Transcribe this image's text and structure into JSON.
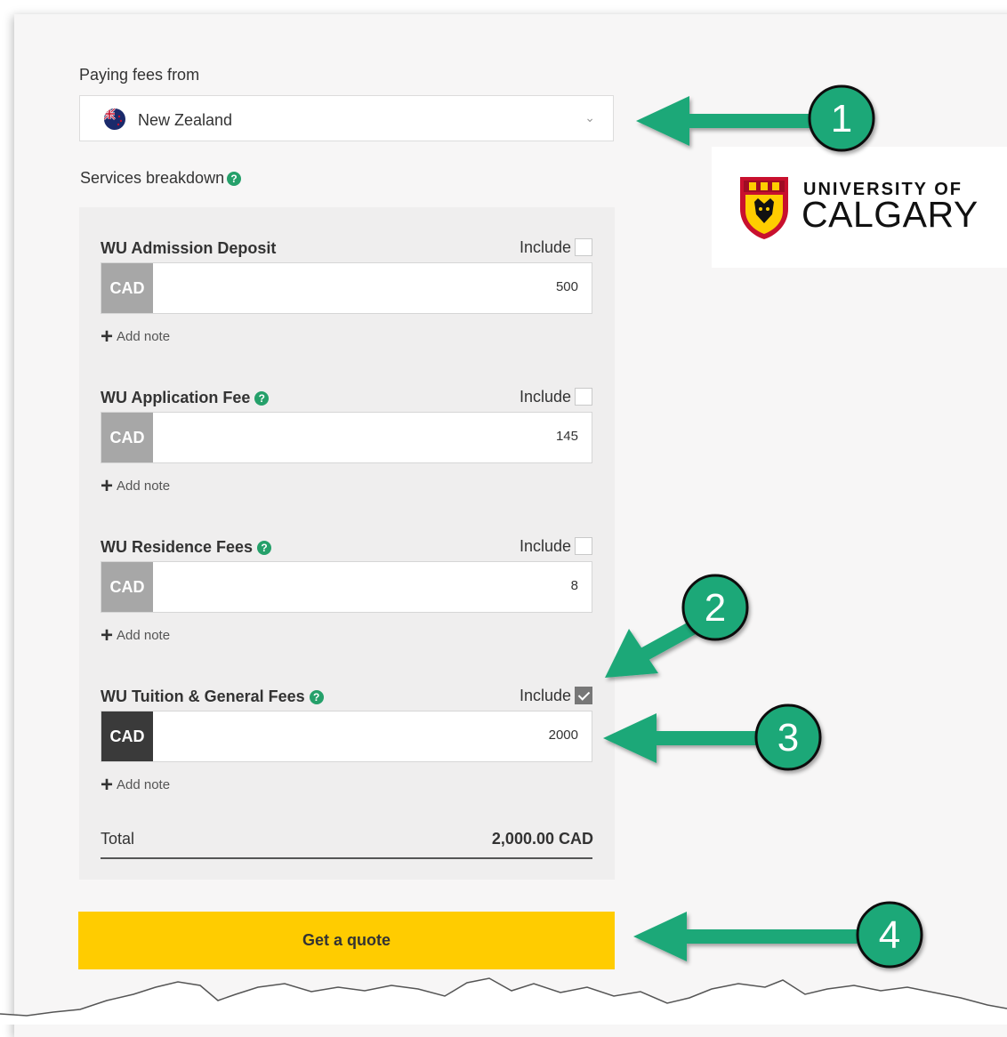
{
  "form": {
    "paying_label": "Paying fees from",
    "country": "New Zealand",
    "services_label": "Services breakdown",
    "help_glyph": "?"
  },
  "fees": [
    {
      "name": "WU Admission Deposit",
      "include_label": "Include",
      "included": false,
      "currency": "CAD",
      "amount": "500",
      "add_note": "Add note",
      "help": false
    },
    {
      "name": "WU Application Fee",
      "include_label": "Include",
      "included": false,
      "currency": "CAD",
      "amount": "145",
      "add_note": "Add note",
      "help": true
    },
    {
      "name": "WU Residence Fees",
      "include_label": "Include",
      "included": false,
      "currency": "CAD",
      "amount": "8",
      "add_note": "Add note",
      "help": true
    },
    {
      "name": "WU Tuition & General Fees",
      "include_label": "Include",
      "included": true,
      "currency": "CAD",
      "amount": "2000",
      "add_note": "Add note",
      "help": true
    }
  ],
  "total": {
    "label": "Total",
    "value": "2,000.00 CAD"
  },
  "cta": {
    "label": "Get a quote"
  },
  "logo": {
    "line1": "UNIVERSITY OF",
    "line2": "CALGARY"
  },
  "callouts": [
    "1",
    "2",
    "3",
    "4"
  ],
  "colors": {
    "accent_green": "#1fa878",
    "cta_yellow": "#ffcc00",
    "help_green": "#25a06a"
  }
}
